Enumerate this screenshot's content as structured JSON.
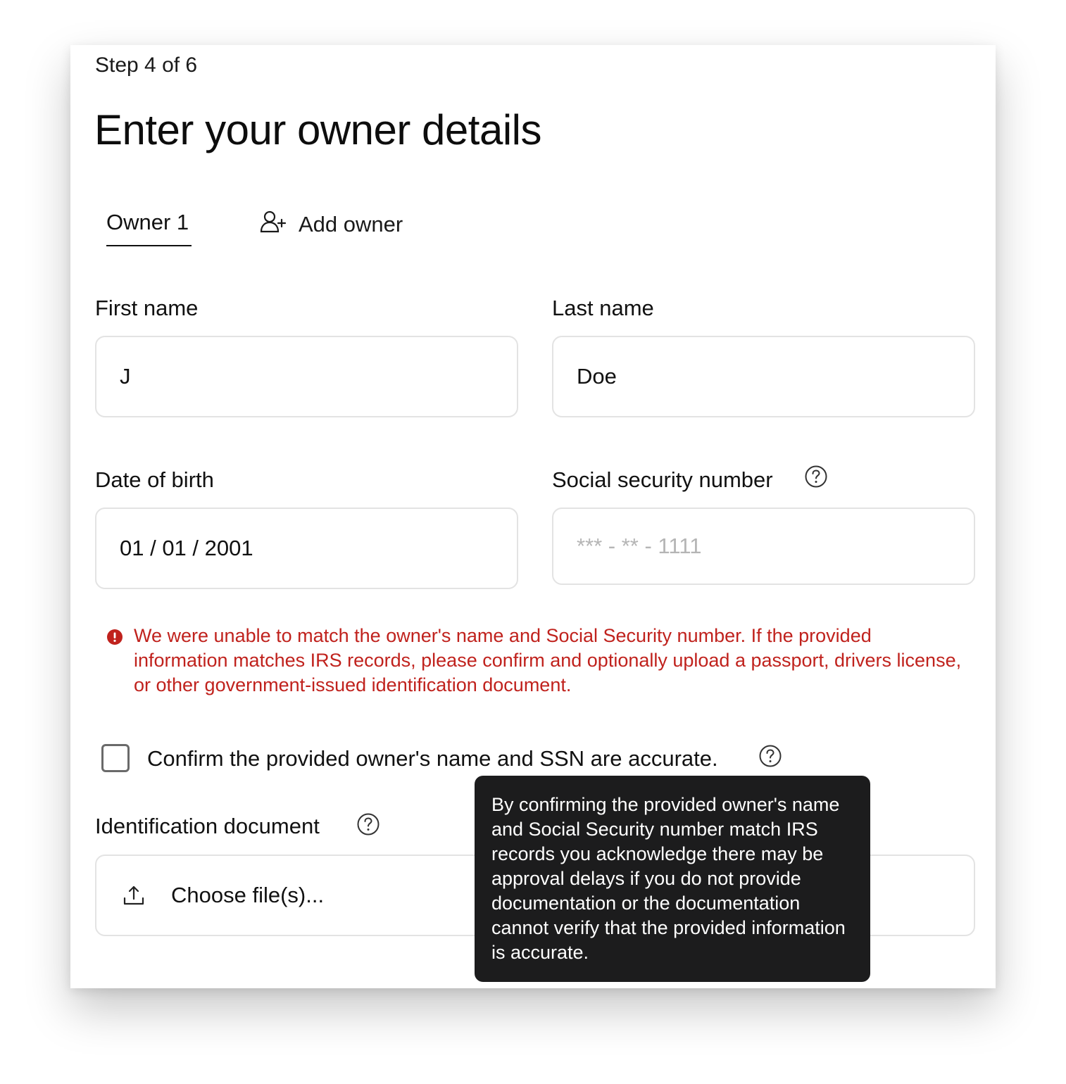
{
  "step": "Step 4 of 6",
  "title": "Enter your owner details",
  "tabs": {
    "owner1": "Owner 1",
    "add_owner": "Add owner"
  },
  "fields": {
    "first_name": {
      "label": "First name",
      "value": "J"
    },
    "last_name": {
      "label": "Last name",
      "value": "Doe"
    },
    "dob": {
      "label": "Date of birth",
      "value": "01 / 01 / 2001"
    },
    "ssn": {
      "label": "Social security number",
      "value": "*** - ** - 1111"
    }
  },
  "error": "We were unable to match the owner's name and Social Security number. If the provided information matches IRS records, please confirm and optionally upload a passport, drivers license, or other government-issued identification document.",
  "confirm": {
    "label": "Confirm the provided owner's name and SSN are accurate.",
    "checked": false
  },
  "identification": {
    "label": "Identification document",
    "button": "Choose file(s)..."
  },
  "tooltip": "By confirming the provided owner's name and Social Security number match IRS records you acknowledge there may be approval delays if you do not provide documentation or the documentation cannot verify that the provided information is accurate.",
  "colors": {
    "error": "#c0221d",
    "tooltip_bg": "#1c1c1d",
    "border": "#e3e3e3"
  },
  "icons": [
    "add-user-icon",
    "help-icon",
    "error-icon",
    "upload-icon"
  ]
}
